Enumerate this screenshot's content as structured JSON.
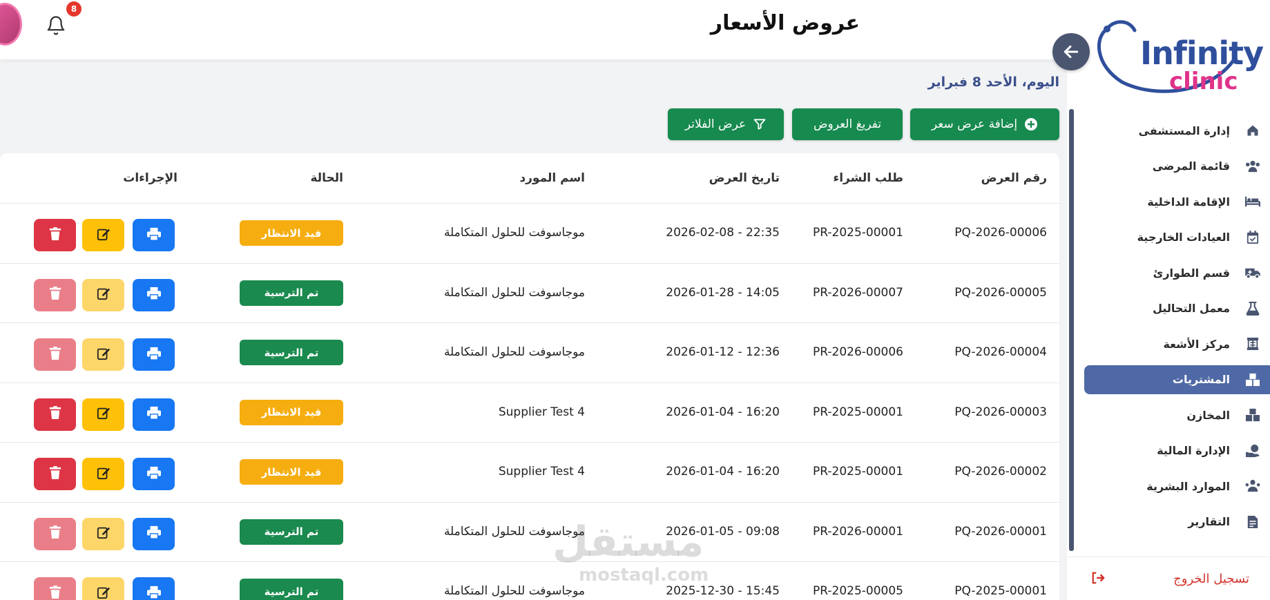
{
  "header": {
    "title": "عروض الأسعار",
    "notification_count": "8",
    "date_text": "اليوم، الأحد 8 فبراير"
  },
  "brand": {
    "line1": "Infinity",
    "line2": "clinic",
    "primary": "#2f4f9c",
    "accent": "#e0338a"
  },
  "toolbar": {
    "add_label": "إضافة عرض سعر",
    "empty_label": "تفريغ العروض",
    "filter_label": "عرض الفلاتر"
  },
  "sidebar": {
    "items": [
      {
        "label": "إدارة المستشفى",
        "icon": "home-icon"
      },
      {
        "label": "قائمة المرضى",
        "icon": "users-icon"
      },
      {
        "label": "الإقامة الداخلية",
        "icon": "bed-icon"
      },
      {
        "label": "العيادات الخارجية",
        "icon": "calendar-icon"
      },
      {
        "label": "قسم الطوارئ",
        "icon": "ambulance-icon"
      },
      {
        "label": "معمل التحاليل",
        "icon": "flask-icon"
      },
      {
        "label": "مركز الأشعة",
        "icon": "xray-icon"
      },
      {
        "label": "المشتريات",
        "icon": "boxes-icon",
        "active": true
      },
      {
        "label": "المخازن",
        "icon": "warehouse-icon"
      },
      {
        "label": "الإدارة المالية",
        "icon": "finance-icon"
      },
      {
        "label": "الموارد البشرية",
        "icon": "hr-icon"
      },
      {
        "label": "التقارير",
        "icon": "report-icon"
      }
    ],
    "logout_label": "تسجيل الخروج"
  },
  "table": {
    "columns": [
      "رقم العرض",
      "طلب الشراء",
      "تاريخ العرض",
      "اسم المورد",
      "الحالة",
      "الإجراءات"
    ],
    "rows": [
      {
        "id": "PQ-2026-00006",
        "pr": "PR-2025-00001",
        "date": "2026-02-08 - 22:35",
        "supplier": "موجاسوفت للحلول المتكاملة",
        "status": "قيد الانتظار",
        "status_type": "pending"
      },
      {
        "id": "PQ-2026-00005",
        "pr": "PR-2026-00007",
        "date": "2026-01-28 - 14:05",
        "supplier": "موجاسوفت للحلول المتكاملة",
        "status": "تم الترسية",
        "status_type": "awarded"
      },
      {
        "id": "PQ-2026-00004",
        "pr": "PR-2026-00006",
        "date": "2026-01-12 - 12:36",
        "supplier": "موجاسوفت للحلول المتكاملة",
        "status": "تم الترسية",
        "status_type": "awarded"
      },
      {
        "id": "PQ-2026-00003",
        "pr": "PR-2025-00001",
        "date": "2026-01-04 - 16:20",
        "supplier": "Supplier Test 4",
        "status": "قيد الانتظار",
        "status_type": "pending"
      },
      {
        "id": "PQ-2026-00002",
        "pr": "PR-2025-00001",
        "date": "2026-01-04 - 16:20",
        "supplier": "Supplier Test 4",
        "status": "قيد الانتظار",
        "status_type": "pending"
      },
      {
        "id": "PQ-2026-00001",
        "pr": "PR-2026-00001",
        "date": "2026-01-05 - 09:08",
        "supplier": "موجاسوفت للحلول المتكاملة",
        "status": "تم الترسية",
        "status_type": "awarded"
      },
      {
        "id": "PQ-2025-00001",
        "pr": "PR-2025-00005",
        "date": "2025-12-30 - 15:45",
        "supplier": "موجاسوفت للحلول المتكاملة",
        "status": "تم الترسية",
        "status_type": "awarded"
      }
    ]
  },
  "watermark": {
    "text": "مستقل",
    "domain": "mostaql.com"
  }
}
